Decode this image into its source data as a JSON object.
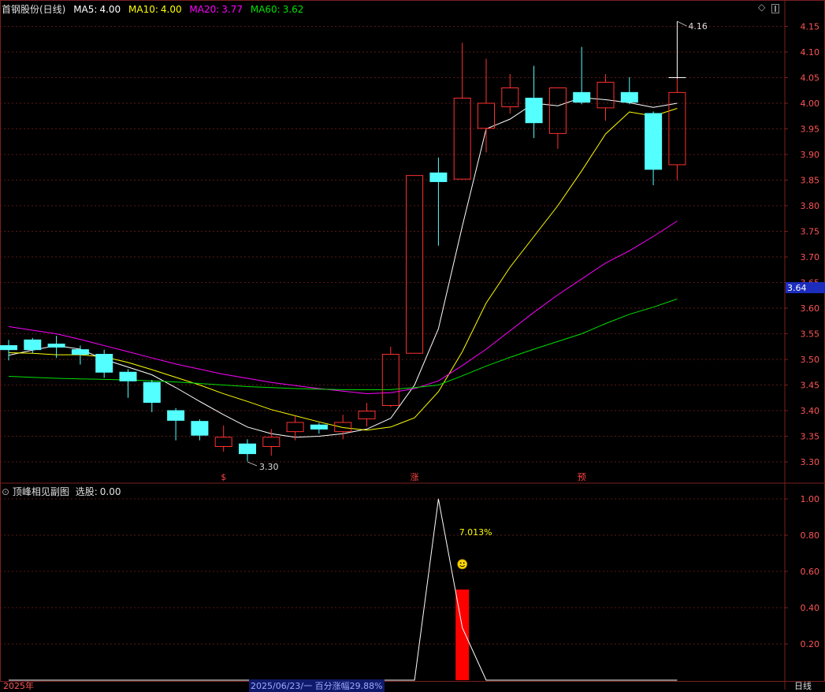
{
  "header": {
    "title": "首钢股份(日线)",
    "ma": [
      {
        "label": "MA5:",
        "value": "4.00",
        "color": "#ffffff"
      },
      {
        "label": "MA10:",
        "value": "4.00",
        "color": "#ffff00"
      },
      {
        "label": "MA20:",
        "value": "3.77",
        "color": "#ff00ff"
      },
      {
        "label": "MA60:",
        "value": "3.62",
        "color": "#00e000"
      }
    ]
  },
  "sub_header": {
    "title": "顶峰相见副图",
    "xg_label": "选股:",
    "xg_value": "0.00"
  },
  "colors": {
    "up": "#ff3030",
    "down": "#54ffff",
    "grid": "#7a1f1f",
    "axis_text": "#ff5555",
    "last_price_bg": "#1c2dbd"
  },
  "chart_data": [
    {
      "type": "candlestick",
      "title": "首钢股份(日线)",
      "ylim": [
        3.26,
        4.18
      ],
      "y_ticks": [
        "4.15",
        "4.10",
        "4.05",
        "4.00",
        "3.95",
        "3.90",
        "3.85",
        "3.80",
        "3.75",
        "3.70",
        "3.65",
        "3.60",
        "3.55",
        "3.50",
        "3.45",
        "3.40",
        "3.35",
        "3.30"
      ],
      "last_price_tag": "3.64",
      "annotations": {
        "high": "4.16",
        "low": "3.30"
      },
      "markers": [
        "$",
        "涨",
        "预"
      ],
      "candles": [
        {
          "o": 3.527,
          "c": 3.519,
          "h": 3.538,
          "l": 3.498
        },
        {
          "o": 3.538,
          "c": 3.519,
          "h": 3.542,
          "l": 3.512
        },
        {
          "o": 3.53,
          "c": 3.524,
          "h": 3.546,
          "l": 3.503
        },
        {
          "o": 3.519,
          "c": 3.51,
          "h": 3.527,
          "l": 3.49
        },
        {
          "o": 3.51,
          "c": 3.475,
          "h": 3.519,
          "l": 3.464
        },
        {
          "o": 3.475,
          "c": 3.458,
          "h": 3.481,
          "l": 3.425
        },
        {
          "o": 3.455,
          "c": 3.416,
          "h": 3.46,
          "l": 3.397
        },
        {
          "o": 3.4,
          "c": 3.381,
          "h": 3.405,
          "l": 3.342
        },
        {
          "o": 3.379,
          "c": 3.352,
          "h": 3.383,
          "l": 3.342
        },
        {
          "o": 3.33,
          "c": 3.348,
          "h": 3.371,
          "l": 3.32
        },
        {
          "o": 3.335,
          "c": 3.316,
          "h": 3.344,
          "l": 3.301
        },
        {
          "o": 3.33,
          "c": 3.348,
          "h": 3.364,
          "l": 3.312
        },
        {
          "o": 3.359,
          "c": 3.377,
          "h": 3.39,
          "l": 3.342
        },
        {
          "o": 3.372,
          "c": 3.364,
          "h": 3.376,
          "l": 3.355
        },
        {
          "o": 3.359,
          "c": 3.377,
          "h": 3.392,
          "l": 3.344
        },
        {
          "o": 3.384,
          "c": 3.399,
          "h": 3.415,
          "l": 3.369
        },
        {
          "o": 3.41,
          "c": 3.51,
          "h": 3.525,
          "l": 3.407
        },
        {
          "o": 3.512,
          "c": 3.859,
          "h": 3.859,
          "l": 3.512
        },
        {
          "o": 3.864,
          "c": 3.847,
          "h": 3.894,
          "l": 3.722
        },
        {
          "o": 3.852,
          "c": 4.01,
          "h": 4.118,
          "l": 3.852
        },
        {
          "o": 3.951,
          "c": 4.0,
          "h": 4.087,
          "l": 3.904
        },
        {
          "o": 3.993,
          "c": 4.03,
          "h": 4.057,
          "l": 3.98
        },
        {
          "o": 4.01,
          "c": 3.962,
          "h": 4.073,
          "l": 3.932
        },
        {
          "o": 3.941,
          "c": 4.03,
          "h": 4.03,
          "l": 3.911
        },
        {
          "o": 4.021,
          "c": 4.002,
          "h": 4.11,
          "l": 3.998
        },
        {
          "o": 3.991,
          "c": 4.041,
          "h": 4.057,
          "l": 3.966
        },
        {
          "o": 4.021,
          "c": 4.002,
          "h": 4.051,
          "l": 3.998
        },
        {
          "o": 3.98,
          "c": 3.871,
          "h": 3.984,
          "l": 3.84
        },
        {
          "o": 3.88,
          "c": 4.021,
          "h": 4.051,
          "l": 3.85
        }
      ],
      "ma_series": [
        {
          "name": "MA5",
          "color": "#ffffff",
          "values": [
            3.508,
            3.518,
            3.527,
            3.52,
            3.5,
            3.485,
            3.47,
            3.445,
            3.418,
            3.392,
            3.368,
            3.355,
            3.348,
            3.35,
            3.355,
            3.364,
            3.385,
            3.45,
            3.56,
            3.76,
            3.95,
            3.969,
            4.0,
            3.995,
            4.011,
            4.007,
            4.001,
            3.992,
            4.0
          ]
        },
        {
          "name": "MA10",
          "color": "#ffff00",
          "values": [
            3.513,
            3.512,
            3.509,
            3.509,
            3.505,
            3.494,
            3.48,
            3.465,
            3.45,
            3.433,
            3.418,
            3.402,
            3.39,
            3.378,
            3.367,
            3.362,
            3.368,
            3.386,
            3.437,
            3.515,
            3.61,
            3.68,
            3.74,
            3.8,
            3.868,
            3.94,
            3.983,
            3.975,
            3.99
          ]
        },
        {
          "name": "MA20",
          "color": "#ff00ff",
          "values": [
            3.564,
            3.557,
            3.55,
            3.539,
            3.527,
            3.515,
            3.503,
            3.491,
            3.481,
            3.471,
            3.463,
            3.455,
            3.449,
            3.443,
            3.438,
            3.433,
            3.435,
            3.443,
            3.458,
            3.488,
            3.52,
            3.556,
            3.592,
            3.626,
            3.657,
            3.688,
            3.712,
            3.74,
            3.77
          ]
        },
        {
          "name": "MA60",
          "color": "#00e000",
          "values": [
            3.467,
            3.465,
            3.463,
            3.462,
            3.461,
            3.46,
            3.458,
            3.456,
            3.453,
            3.45,
            3.447,
            3.445,
            3.443,
            3.442,
            3.441,
            3.441,
            3.441,
            3.445,
            3.45,
            3.468,
            3.487,
            3.504,
            3.52,
            3.535,
            3.55,
            3.57,
            3.588,
            3.602,
            3.618
          ]
        }
      ]
    },
    {
      "type": "line",
      "title": "顶峰相见副图",
      "ylim": [
        0,
        1.0
      ],
      "y_ticks": [
        "1.00",
        "0.80",
        "0.60",
        "0.40",
        "0.20"
      ],
      "values": [
        0,
        0,
        0,
        0,
        0,
        0,
        0,
        0,
        0,
        0,
        0,
        0,
        0,
        0,
        0,
        0,
        0,
        0,
        1.0,
        0.29,
        0,
        0,
        0,
        0,
        0,
        0,
        0,
        0,
        0
      ],
      "bar": {
        "index": 19,
        "value": 0.5
      },
      "annotation": "7.013%"
    }
  ],
  "footer": {
    "year_left": "2025年",
    "date": "2025/06/23/一 百分涨幅29.88%",
    "right_label": "日线"
  }
}
